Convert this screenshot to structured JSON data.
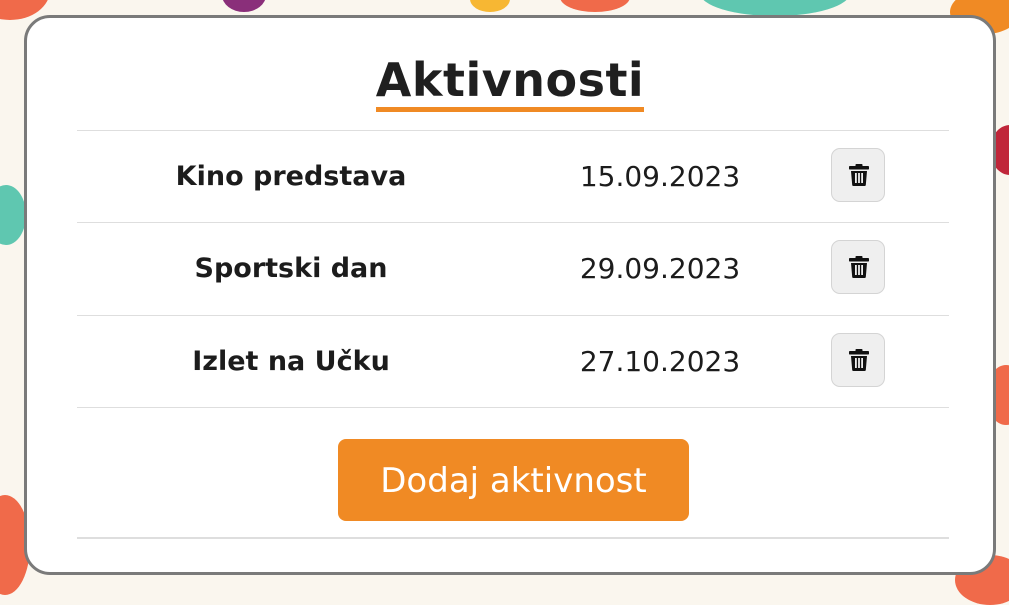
{
  "page": {
    "title": "Aktivnosti",
    "accent_color": "#f08a24"
  },
  "activities": [
    {
      "name": "Kino predstava",
      "date": "15.09.2023",
      "delete_icon": "trash-icon"
    },
    {
      "name": "Sportski dan",
      "date": "29.09.2023",
      "delete_icon": "trash-icon"
    },
    {
      "name": "Izlet na Učku",
      "date": "27.10.2023",
      "delete_icon": "trash-icon"
    }
  ],
  "actions": {
    "add_label": "Dodaj aktivnost"
  }
}
